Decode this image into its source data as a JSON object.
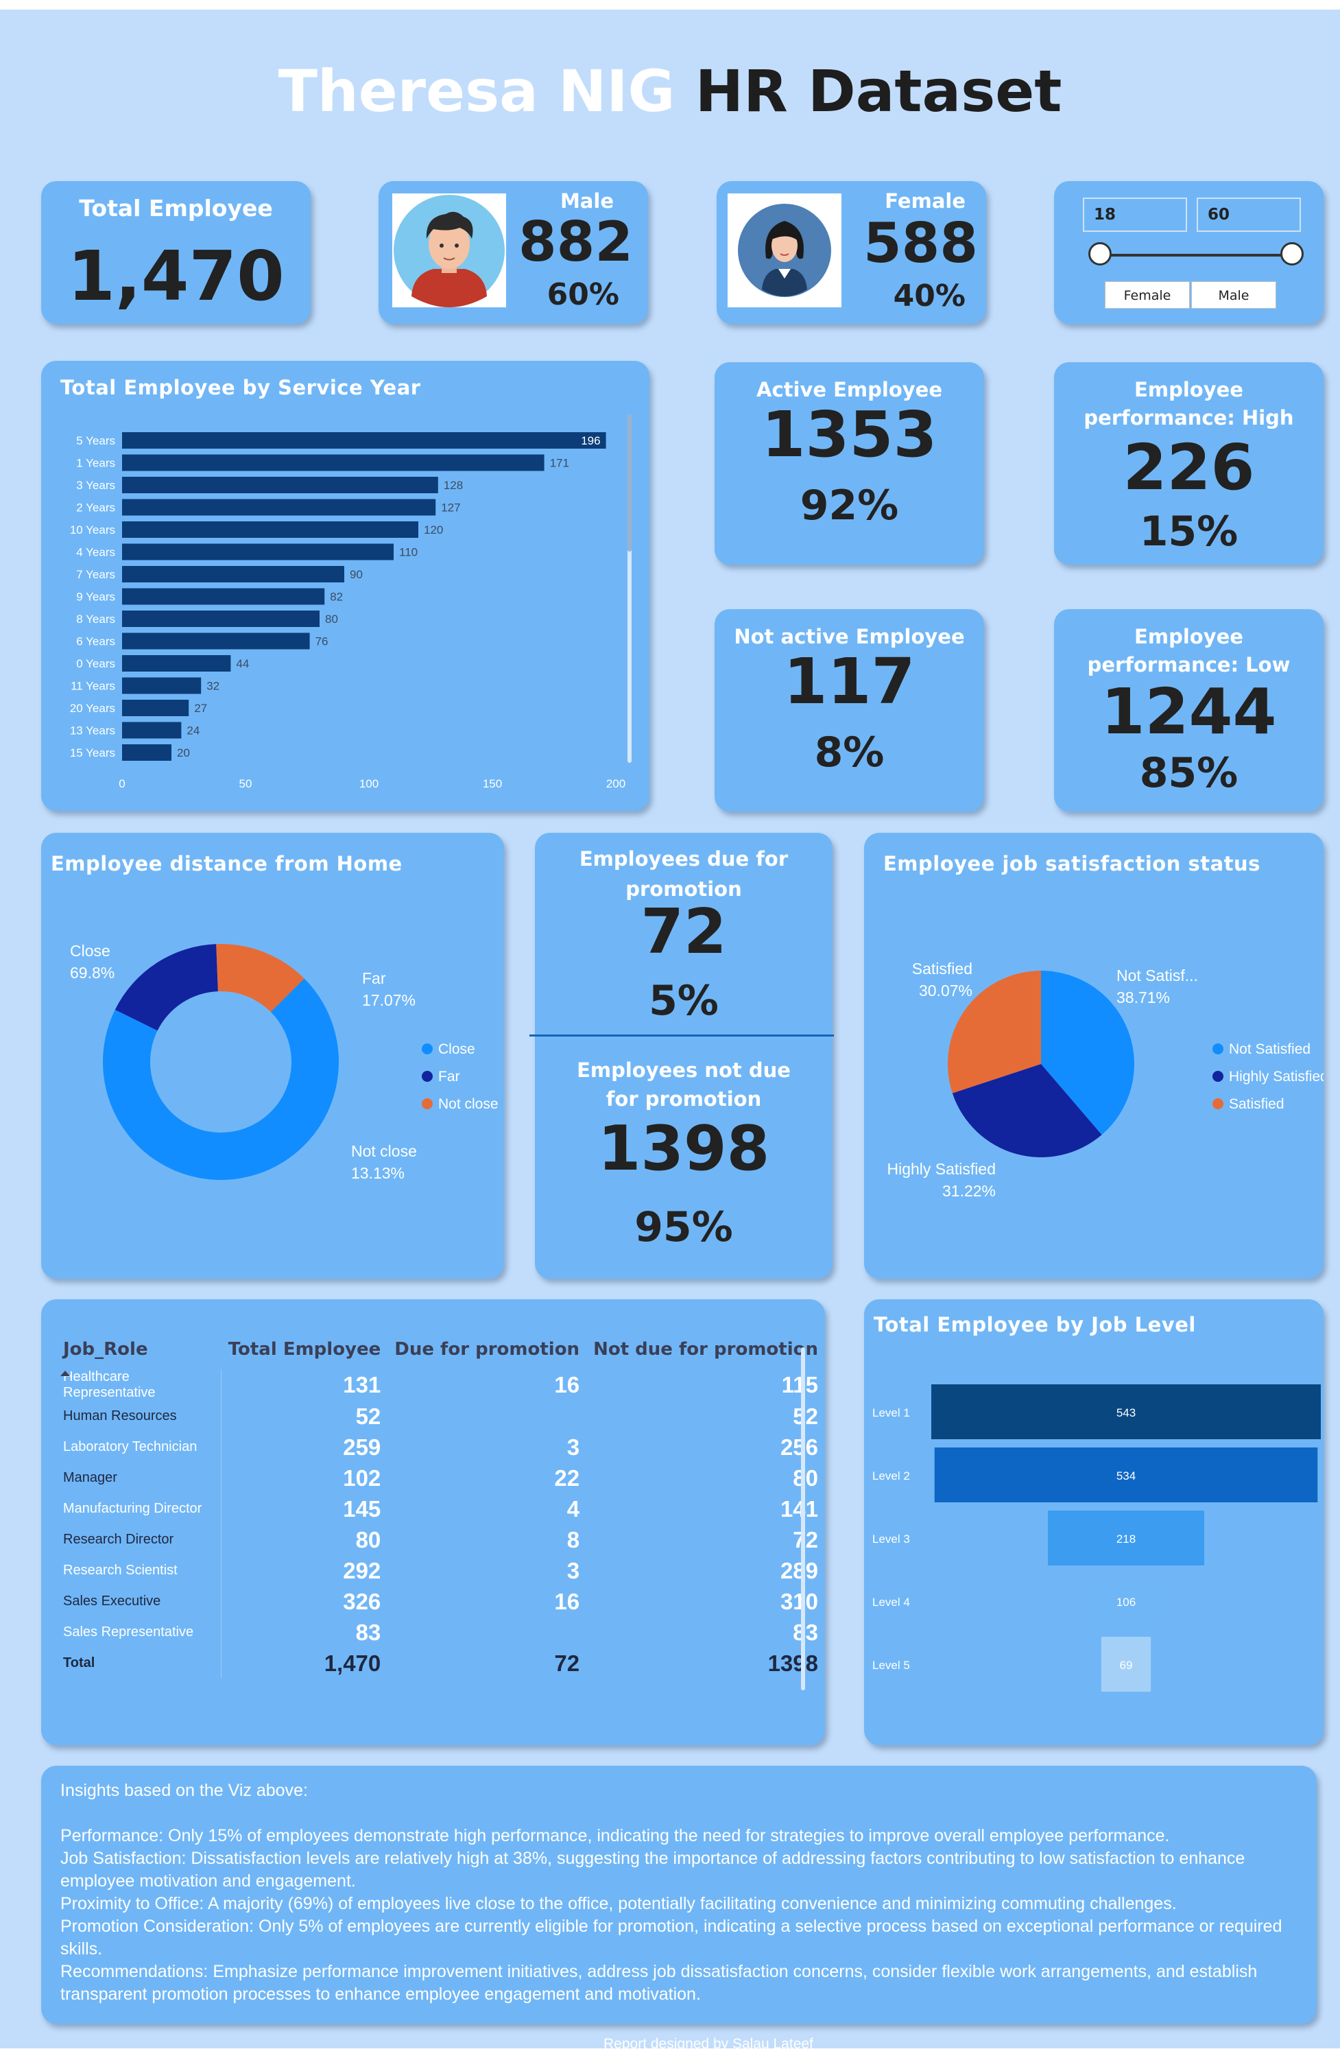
{
  "title": {
    "part1": "Theresa NIG",
    "part2": "HR Dataset"
  },
  "kpis": {
    "total_employee": {
      "label": "Total Employee",
      "value": "1,470"
    },
    "male": {
      "label": "Male",
      "value": "882",
      "pct": "60%"
    },
    "female": {
      "label": "Female",
      "value": "588",
      "pct": "40%"
    },
    "active": {
      "label": "Active Employee",
      "value": "1353",
      "pct": "92%"
    },
    "perf_high": {
      "label_line1": "Employee",
      "label_line2": "performance: High",
      "value": "226",
      "pct": "15%"
    },
    "not_active": {
      "label": "Not active Employee",
      "value": "117",
      "pct": "8%"
    },
    "perf_low": {
      "label_line1": "Employee",
      "label_line2": "performance: Low",
      "value": "1244",
      "pct": "85%"
    },
    "due_promo": {
      "label_line1": "Employees due for",
      "label_line2": "promotion",
      "value": "72",
      "pct": "5%"
    },
    "not_due_promo": {
      "label_line1": "Employees not due",
      "label_line2": "for promotion",
      "value": "1398",
      "pct": "95%"
    }
  },
  "slicer": {
    "age_min": "18",
    "age_max": "60",
    "gender_options": [
      "Female",
      "Male"
    ]
  },
  "service_year_title": "Total Employee by Service Year",
  "distance_title": "Employee distance from Home",
  "satisfaction_title": "Employee job satisfaction status",
  "job_level_title": "Total Employee by Job Level",
  "chart_data": [
    {
      "type": "bar",
      "orientation": "horizontal",
      "title": "Total Employee by Service Year",
      "categories": [
        "5 Years",
        "1 Years",
        "3 Years",
        "2 Years",
        "10 Years",
        "4 Years",
        "7 Years",
        "9 Years",
        "8 Years",
        "6 Years",
        "0 Years",
        "11 Years",
        "20 Years",
        "13 Years",
        "15 Years"
      ],
      "values": [
        196,
        171,
        128,
        127,
        120,
        110,
        90,
        82,
        80,
        76,
        44,
        32,
        27,
        24,
        20
      ],
      "xlim": [
        0,
        200
      ],
      "xticks": [
        0,
        50,
        100,
        150,
        200
      ],
      "color": "#0c3d78"
    },
    {
      "type": "pie",
      "donut": true,
      "title": "Employee distance from Home",
      "categories": [
        "Close",
        "Far",
        "Not close"
      ],
      "values": [
        69.8,
        17.07,
        13.13
      ],
      "labels": [
        "Close 69.8%",
        "Far 17.07%",
        "Not close 13.13%"
      ],
      "colors": [
        "#118dff",
        "#12239e",
        "#e66c37"
      ],
      "legend": "right"
    },
    {
      "type": "pie",
      "title": "Employee job satisfaction status",
      "categories": [
        "Not Satisfied",
        "Highly Satisfied",
        "Satisfied"
      ],
      "values": [
        38.71,
        31.22,
        30.07
      ],
      "labels": [
        "Not Satisf... 38.71%",
        "Highly Satisfied 31.22%",
        "Satisfied 30.07%"
      ],
      "colors": [
        "#118dff",
        "#12239e",
        "#e66c37"
      ],
      "legend": "right"
    },
    {
      "type": "bar",
      "orientation": "funnel",
      "title": "Total Employee by Job Level",
      "categories": [
        "Level 1",
        "Level 2",
        "Level 3",
        "Level 4",
        "Level 5"
      ],
      "values": [
        543,
        534,
        218,
        106,
        69
      ],
      "colors": [
        "#094780",
        "#0e66c4",
        "#3b9cf0",
        "#6fb6f6",
        "#a4d0f8"
      ]
    }
  ],
  "role_table": {
    "headers": [
      "Job_Role",
      "Total Employee",
      "Due for promotion",
      "Not due for promotion"
    ],
    "rows": [
      [
        "Healthcare Representative",
        "131",
        "16",
        "115"
      ],
      [
        "Human Resources",
        "52",
        "",
        "52"
      ],
      [
        "Laboratory Technician",
        "259",
        "3",
        "256"
      ],
      [
        "Manager",
        "102",
        "22",
        "80"
      ],
      [
        "Manufacturing Director",
        "145",
        "4",
        "141"
      ],
      [
        "Research Director",
        "80",
        "8",
        "72"
      ],
      [
        "Research Scientist",
        "292",
        "3",
        "289"
      ],
      [
        "Sales Executive",
        "326",
        "16",
        "310"
      ],
      [
        "Sales Representative",
        "83",
        "",
        "83"
      ]
    ],
    "total": [
      "Total",
      "1,470",
      "72",
      "1398"
    ]
  },
  "insights": {
    "heading": "Insights based on the Viz above:",
    "lines": [
      "Performance: Only 15% of employees demonstrate high performance, indicating the need for strategies to improve overall employee performance.",
      "Job Satisfaction: Dissatisfaction levels are relatively high at 38%, suggesting the importance of addressing factors contributing to low satisfaction to enhance employee motivation and engagement.",
      "Proximity to Office: A majority (69%) of employees live close to the office, potentially facilitating convenience and minimizing commuting challenges.",
      "Promotion Consideration: Only 5% of employees are currently eligible for promotion, indicating a selective process based on exceptional performance or required skills.",
      "Recommendations: Emphasize performance improvement initiatives, address job dissatisfaction concerns, consider flexible work arrangements, and establish transparent promotion processes to enhance employee engagement and motivation."
    ]
  },
  "footer": "Report designed by Salau Lateef",
  "colors": {
    "background": "#c2ddfb",
    "card": "#70b6f6",
    "bar": "#0c3d78",
    "blue": "#118dff",
    "navy": "#12239e",
    "orange": "#e66c37"
  }
}
